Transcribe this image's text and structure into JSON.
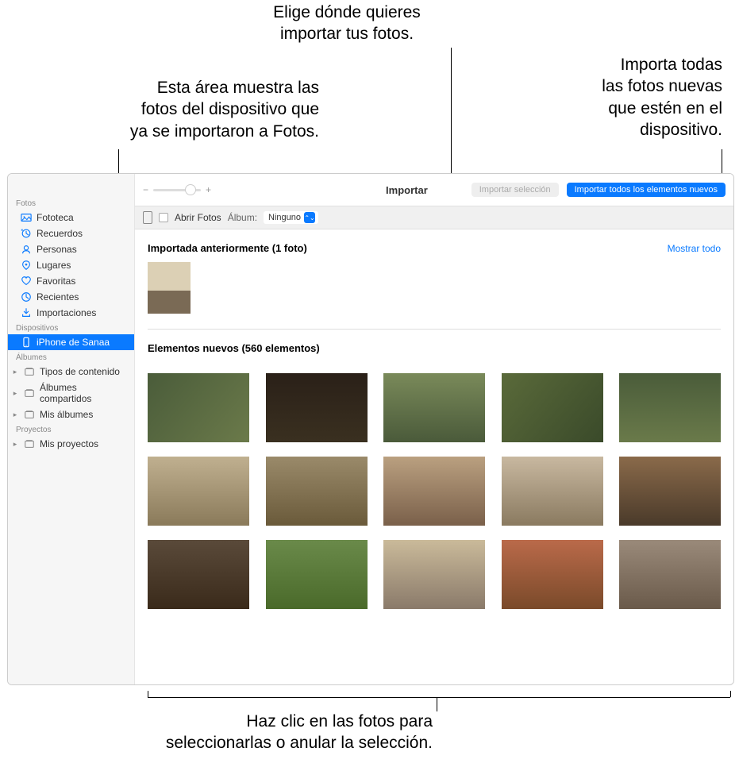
{
  "annotations": {
    "top_center": "Elige dónde quieres\nimportar tus fotos.",
    "top_left": "Esta área muestra las\nfotos del dispositivo que\nya se importaron a Fotos.",
    "top_right": "Importa todas\nlas fotos nuevas\nque estén en el\ndispositivo.",
    "bottom": "Haz clic en las fotos para\nseleccionarlas o anular la selección."
  },
  "sidebar": {
    "sections": {
      "fotos": "Fotos",
      "dispositivos": "Dispositivos",
      "albumes": "Álbumes",
      "proyectos": "Proyectos"
    },
    "items": {
      "fototeca": "Fototeca",
      "recuerdos": "Recuerdos",
      "personas": "Personas",
      "lugares": "Lugares",
      "favoritas": "Favoritas",
      "recientes": "Recientes",
      "importaciones": "Importaciones",
      "device": "iPhone de Sanaa",
      "tipos_contenido": "Tipos de contenido",
      "albumes_compartidos": "Álbumes compartidos",
      "mis_albumes": "Mis álbumes",
      "mis_proyectos": "Mis proyectos"
    }
  },
  "toolbar": {
    "import_title": "Importar",
    "import_selected": "Importar selección",
    "import_all_new": "Importar todos los elementos nuevos"
  },
  "subbar": {
    "open_photos": "Abrir Fotos",
    "album_label": "Álbum:",
    "album_value": "Ninguno"
  },
  "content": {
    "already_imported_header": "Importada anteriormente (1 foto)",
    "show_all": "Mostrar todo",
    "new_items_header": "Elementos nuevos (560 elementos)"
  },
  "colors": {
    "accent": "#0a7aff"
  }
}
